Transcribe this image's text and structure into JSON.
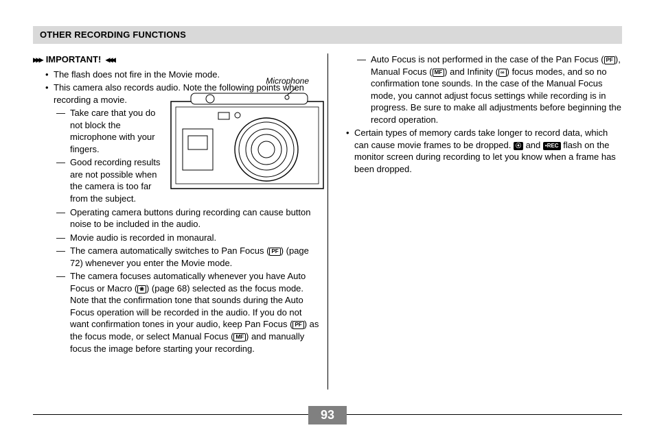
{
  "header": {
    "title": "OTHER RECORDING FUNCTIONS"
  },
  "important_label": "IMPORTANT!",
  "microphone_label": "Microphone",
  "left": {
    "b1": "The flash does not fire in the Movie mode.",
    "b2": "This camera also records audio. Note the following points when recording a movie.",
    "d1": "Take care that you do not block the microphone with your fingers.",
    "d2": "Good recording results are not possible when the camera is too far from the subject.",
    "d3": "Operating camera buttons during recording can cause button noise to be included in the audio.",
    "d4": "Movie audio is recorded in monaural.",
    "d5a": "The camera automatically switches to Pan Focus (",
    "d5b": ") (page 72) whenever you enter the Movie mode.",
    "d6a": "The camera focuses automatically whenever you have Auto Focus or Macro (",
    "d6b": ") (page 68) selected as the focus mode. Note that the confirmation tone that sounds during the Auto Focus operation will be recorded in the audio. If you do not want confirmation tones in your audio, keep Pan Focus (",
    "d6c": ") as the focus mode, or select Manual Focus (",
    "d6d": ") and manually focus the image before starting your recording."
  },
  "right": {
    "d1a": "Auto Focus is not performed in the case of the Pan Focus (",
    "d1b": "), Manual Focus (",
    "d1c": ") and Infinity (",
    "d1d": ") focus modes, and so no confirmation tone sounds. In the case of the Manual Focus mode, you cannot adjust focus settings while recording is in progress. Be sure to make all adjustments before beginning the record operation.",
    "b1a": "Certain types of memory cards take longer to record data, which can cause movie frames to be dropped. ",
    "b1b": " and ",
    "b1c": " flash on the monitor screen during recording to let you know when a frame has been dropped."
  },
  "icons": {
    "pf": "PF",
    "mf": "MF",
    "macro": "❀",
    "infinity": "∞",
    "movie": "⦿",
    "rec": "•REC"
  },
  "page_number": "93"
}
